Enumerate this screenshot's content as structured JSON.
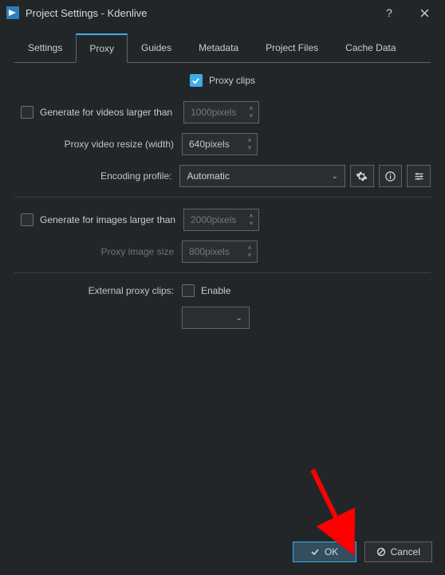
{
  "window": {
    "title": "Project Settings - Kdenlive"
  },
  "tabs": {
    "settings": "Settings",
    "proxy": "Proxy",
    "guides": "Guides",
    "metadata": "Metadata",
    "projectfiles": "Project Files",
    "cachedata": "Cache Data"
  },
  "proxy": {
    "proxy_clips_label": "Proxy clips",
    "gen_videos_label": "Generate for videos larger than",
    "gen_videos_value": "1000pixels",
    "video_resize_label": "Proxy video resize (width)",
    "video_resize_value": "640pixels",
    "encoding_profile_label": "Encoding profile:",
    "encoding_profile_value": "Automatic",
    "gen_images_label": "Generate for images larger than",
    "gen_images_value": "2000pixels",
    "image_size_label": "Proxy image size",
    "image_size_value": "800pixels",
    "external_label": "External proxy clips:",
    "external_enable": "Enable"
  },
  "footer": {
    "ok": "OK",
    "cancel": "Cancel"
  }
}
